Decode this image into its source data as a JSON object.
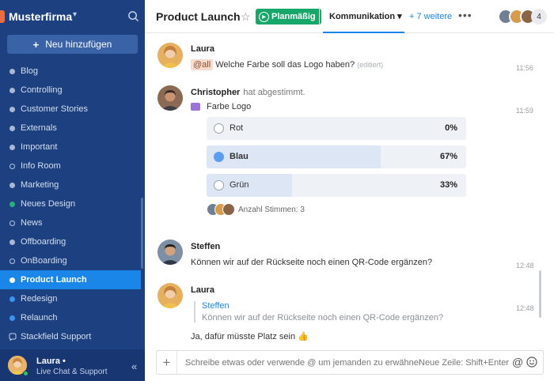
{
  "workspace": {
    "name": "Musterfirma"
  },
  "sidebar": {
    "add_label": "Neu hinzufügen",
    "channels": [
      {
        "label": "Blog"
      },
      {
        "label": "Controlling"
      },
      {
        "label": "Customer Stories"
      },
      {
        "label": "Externals"
      },
      {
        "label": "Important"
      },
      {
        "label": "Info Room"
      },
      {
        "label": "Marketing"
      },
      {
        "label": "Neues Design"
      },
      {
        "label": "News"
      },
      {
        "label": "Offboarding"
      },
      {
        "label": "OnBoarding"
      },
      {
        "label": "Product Launch"
      },
      {
        "label": "Redesign"
      },
      {
        "label": "Relaunch"
      },
      {
        "label": "Stackfield Support"
      }
    ],
    "user": {
      "name": "Laura",
      "status_dot": "•",
      "subtitle": "Live Chat & Support"
    }
  },
  "header": {
    "title": "Product Launch",
    "status_badge": "Planmäßig",
    "active_tab": "Kommunikation",
    "more_tabs": "+ 7 weitere",
    "member_count": "4"
  },
  "messages": {
    "m1": {
      "author": "Laura",
      "mention": "@all",
      "text": "Welche Farbe soll das Logo haben?",
      "edited": "(editiert)",
      "time": "11:56"
    },
    "m2": {
      "author": "Christopher",
      "action": "hat abgestimmt.",
      "time": "11:59",
      "poll": {
        "title": "Farbe Logo",
        "options": [
          {
            "label": "Rot",
            "percent": "0%",
            "value": 0
          },
          {
            "label": "Blau",
            "percent": "67%",
            "value": 67,
            "selected": true
          },
          {
            "label": "Grün",
            "percent": "33%",
            "value": 33
          }
        ],
        "votes": "Anzahl Stimmen: 3"
      }
    },
    "m3": {
      "author": "Steffen",
      "text": "Können wir auf der Rückseite noch einen QR-Code ergänzen?",
      "time": "12:48"
    },
    "m4": {
      "author": "Laura",
      "time": "12:48",
      "quote_author": "Steffen",
      "quote_text": "Können wir auf der Rückseite noch einen QR-Code ergänzen?",
      "text": "Ja, dafür müsste Platz sein",
      "emoji": "👍"
    }
  },
  "composer": {
    "placeholder": "Schreibe etwas oder verwende @ um jemanden zu erwähnen",
    "hint": "Neue Zeile: Shift+Enter"
  },
  "colors": {
    "sidebar_bg": "#1d4180",
    "active_channel": "#1a86e8",
    "status_badge": "#18a76a",
    "poll_fill": "#dce6f4",
    "mention_bg": "#f7dccd"
  },
  "icons": [
    "search-icon",
    "chevron-down-icon",
    "plus-icon",
    "star-icon",
    "play-icon",
    "more-icon",
    "lock-icon",
    "collapse-icon",
    "poll-icon",
    "at-icon",
    "emoji-icon"
  ]
}
